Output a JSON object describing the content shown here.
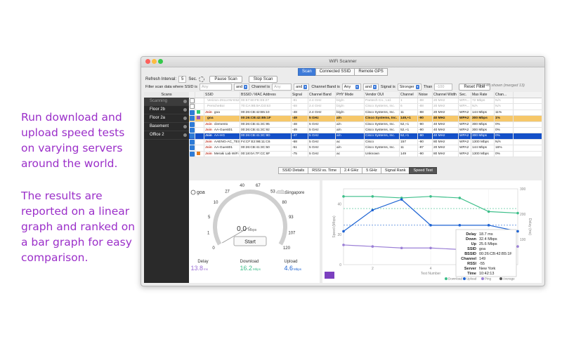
{
  "promo": {
    "para1": "Run download and upload speed tests on varying servers around the world.",
    "para2": "The results are reported on a linear graph and ranked on a bar graph for easy comparison."
  },
  "window": {
    "title": "WiFi Scanner",
    "tabs": [
      "Scan",
      "Connected SSID",
      "Remote GPS"
    ],
    "selected_tab": "Scan"
  },
  "toolbar": {
    "refresh_label": "Refresh Interval:",
    "refresh_value": "5",
    "sec_label": "Sec.",
    "pause_label": "Pause Scan",
    "stop_label": "Stop Scan"
  },
  "filter": {
    "label": "Filter scan data where SSID is",
    "ssid_placeholder": "Any",
    "and1": "and",
    "channel_label": "Channel is",
    "channel_placeholder": "Any",
    "and2": "and",
    "band_label": "Channel Band is",
    "band_value": "Any",
    "and3": "and",
    "signal_label": "Signal is",
    "signal_value": "Stronger",
    "than_label": "Than",
    "than_placeholder": "-100",
    "reset_label": "Reset Filter",
    "status": "33 of 46 shown (merged 13)"
  },
  "scans": {
    "header": "Scans",
    "items": [
      "Scanning",
      "Floor 2b",
      "Floor 2a",
      "Basement",
      "Office 2"
    ],
    "selected": "Scanning"
  },
  "table": {
    "columns": [
      "",
      "",
      "SSID",
      "BSSID / MAC Address",
      "Signal",
      "Channel Band",
      "PHY Mode",
      "Vendor OUI",
      "Channel",
      "Noise",
      "Channel Width",
      "Sec.",
      "Max Rate",
      "Chan..."
    ],
    "rows": [
      {
        "style": "gray",
        "checked": false,
        "color": "#ffffff",
        "join": "",
        "ssid": "Verizon-291LVW-E527",
        "bssid": "00:57:60:FE:E5:27",
        "signal": "-81",
        "band": "2.4 GHz",
        "phy": "b/g/n",
        "vendor": "Pantech Co., Ltd.",
        "ch": "1",
        "noise": "-88",
        "width": "20 MHz",
        "sec": "WPA...",
        "rate": "72 Mbps",
        "util": "N/A"
      },
      {
        "style": "gray",
        "checked": false,
        "color": "#ffffff",
        "join": "",
        "ssid": "PerscheBoi",
        "bssid": "70:CA:9B:9A:D3:53",
        "signal": "-68",
        "band": "2.4 GHz",
        "phy": "b/g/n",
        "vendor": "Cisco Systems, Inc.",
        "ch": "6",
        "noise": "-88",
        "width": "20 MHz",
        "sec": "WPA...",
        "rate": "N/A",
        "util": "N/A"
      },
      {
        "style": "",
        "checked": true,
        "color": "#2ecc71",
        "join": "Join",
        "ssid": "goa",
        "bssid": "00:26:CB:42:B5:10",
        "signal": "-48",
        "band": "2.4 GHz",
        "phy": "b/g/n",
        "vendor": "Cisco Systems, Inc.",
        "ch": "11",
        "noise": "-88",
        "width": "20 MHz",
        "sec": "WPA2",
        "rate": "144 Mbps",
        "util": "11%"
      },
      {
        "style": "hl",
        "checked": true,
        "color": "#9b59b6",
        "join": "",
        "ssid": "goa",
        "bssid": "00:26:CB:42:B5:1F",
        "signal": "-49",
        "band": "5 GHz",
        "phy": "a/n",
        "vendor": "Cisco Systems, Inc.",
        "ch": "149,+1",
        "noise": "-90",
        "width": "40 MHz",
        "sec": "WPA2",
        "rate": "300 Mbps",
        "util": "1%"
      },
      {
        "style": "",
        "checked": true,
        "color": "#ffffff",
        "join": "Join",
        "ssid": "clemento",
        "bssid": "00:26:CB:41:3C:95",
        "signal": "-48",
        "band": "5 GHz",
        "phy": "a/n",
        "vendor": "Cisco Systems, Inc.",
        "ch": "52,+1",
        "noise": "-90",
        "width": "40 MHz",
        "sec": "WPA2",
        "rate": "300 Mbps",
        "util": "0%"
      },
      {
        "style": "",
        "checked": true,
        "color": "#ffffff",
        "join": "Join",
        "ssid": "AA-Guest01",
        "bssid": "00:26:CB:41:3C:92",
        "signal": "-49",
        "band": "5 GHz",
        "phy": "a/n",
        "vendor": "Cisco Systems, Inc.",
        "ch": "52,+1",
        "noise": "-90",
        "width": "40 MHz",
        "sec": "WPA2",
        "rate": "300 Mbps",
        "util": "0%"
      },
      {
        "style": "bl",
        "checked": true,
        "color": "#1450c8",
        "join": "Join",
        "ssid": "AA-HG",
        "bssid": "00:26:CB:41:3C:9D",
        "signal": "-47",
        "band": "5 GHz",
        "phy": "a/n",
        "vendor": "Cisco Systems, Inc.",
        "ch": "52,+1",
        "noise": "-90",
        "width": "40 MHz",
        "sec": "WPA2",
        "rate": "300 Mbps",
        "util": "0%"
      },
      {
        "style": "",
        "checked": true,
        "color": "#ffffff",
        "join": "Join",
        "ssid": "AAENG-AC_TEST",
        "bssid": "F4:CF:E2:9B:11:C6",
        "signal": "-68",
        "band": "5 GHz",
        "phy": "ac",
        "vendor": "Cisco",
        "ch": "157",
        "noise": "-90",
        "width": "80 MHz",
        "sec": "WPA2",
        "rate": "1300 Mbps",
        "util": "N/A"
      },
      {
        "style": "",
        "checked": true,
        "color": "#ffffff",
        "join": "Join",
        "ssid": "AA-Guest01",
        "bssid": "00:26:CB:41:3C:50",
        "signal": "-51",
        "band": "5 GHz",
        "phy": "a/n",
        "vendor": "Cisco Systems, Inc.",
        "ch": "11",
        "noise": "-87",
        "width": "20 MHz",
        "sec": "WPA2",
        "rate": "144 Mbps",
        "util": "16%"
      },
      {
        "style": "",
        "checked": true,
        "color": "#e67e22",
        "join": "Join",
        "ssid": "Meraki Lab WiFi",
        "bssid": "00:18:0A:7F:CC:6F",
        "signal": "-75",
        "band": "5 GHz",
        "phy": "ac",
        "vendor": "Unknown",
        "ch": "149",
        "noise": "-90",
        "width": "80 MHz",
        "sec": "WPA2",
        "rate": "1300 Mbps",
        "util": "0%"
      }
    ]
  },
  "bottom_tabs": [
    "SSID Details",
    "RSSI vs. Time",
    "2.4 GHz",
    "5 GHz",
    "Signal Rank",
    "Speed Test"
  ],
  "bottom_selected": "Speed Test",
  "speedtest": {
    "ssid": "goa",
    "server": "Singapore",
    "scale": [
      "0",
      "1",
      "5",
      "10",
      "27",
      "40",
      "67",
      "53",
      "80",
      "93",
      "107",
      "120"
    ],
    "speed_value": "0.0",
    "speed_unit": "Mbps",
    "speed_fraction": 0,
    "start_label": "Start",
    "delay_label": "Delay",
    "delay_value": "13.8",
    "delay_unit": "ms",
    "download_label": "Download",
    "download_value": "16.2",
    "download_unit": "Mbps",
    "upload_label": "Upload",
    "upload_value": "4.6",
    "upload_unit": "Mbps"
  },
  "chart_data": {
    "type": "line",
    "x": [
      1,
      2,
      3,
      4,
      5,
      6,
      7
    ],
    "xlabel": "Test Number",
    "ylabel": "Speed (Mbps)",
    "y2label": "Delay (ms)",
    "xticks": [
      "2",
      "4",
      "6"
    ],
    "yticks": [
      "0",
      "20",
      "40"
    ],
    "y2ticks": [
      "100",
      "200",
      "300"
    ],
    "xlim": [
      1,
      7
    ],
    "ylim": [
      0,
      50
    ],
    "y2lim": [
      0,
      300
    ],
    "series": [
      {
        "name": "Download",
        "color": "#3dbf8a",
        "values": [
          45,
          45,
          44,
          45,
          44,
          35,
          34
        ]
      },
      {
        "name": "Upload",
        "color": "#1d63d3",
        "values": [
          22,
          36,
          43,
          26,
          26,
          26,
          22
        ]
      },
      {
        "name": "Ping",
        "color": "#9b7fd6",
        "values": [
          13,
          12,
          11,
          11,
          10,
          5,
          12
        ]
      }
    ],
    "averages": {
      "Download": 37,
      "Upload": 26
    },
    "legend": [
      "Download",
      "Upload",
      "Ping",
      "Average"
    ],
    "tooltip": [
      [
        "Delay",
        "18.7 ms"
      ],
      [
        "Down",
        "32.4 Mbps"
      ],
      [
        "Up",
        "25.6 Mbps"
      ],
      [
        "SSID",
        "goa"
      ],
      [
        "BSSID",
        "00:26:CB:42:B5:1F"
      ],
      [
        "Channel",
        "149"
      ],
      [
        "RSSI",
        "-55"
      ],
      [
        "Server",
        "New York"
      ],
      [
        "Time",
        "10:42:13"
      ]
    ]
  }
}
